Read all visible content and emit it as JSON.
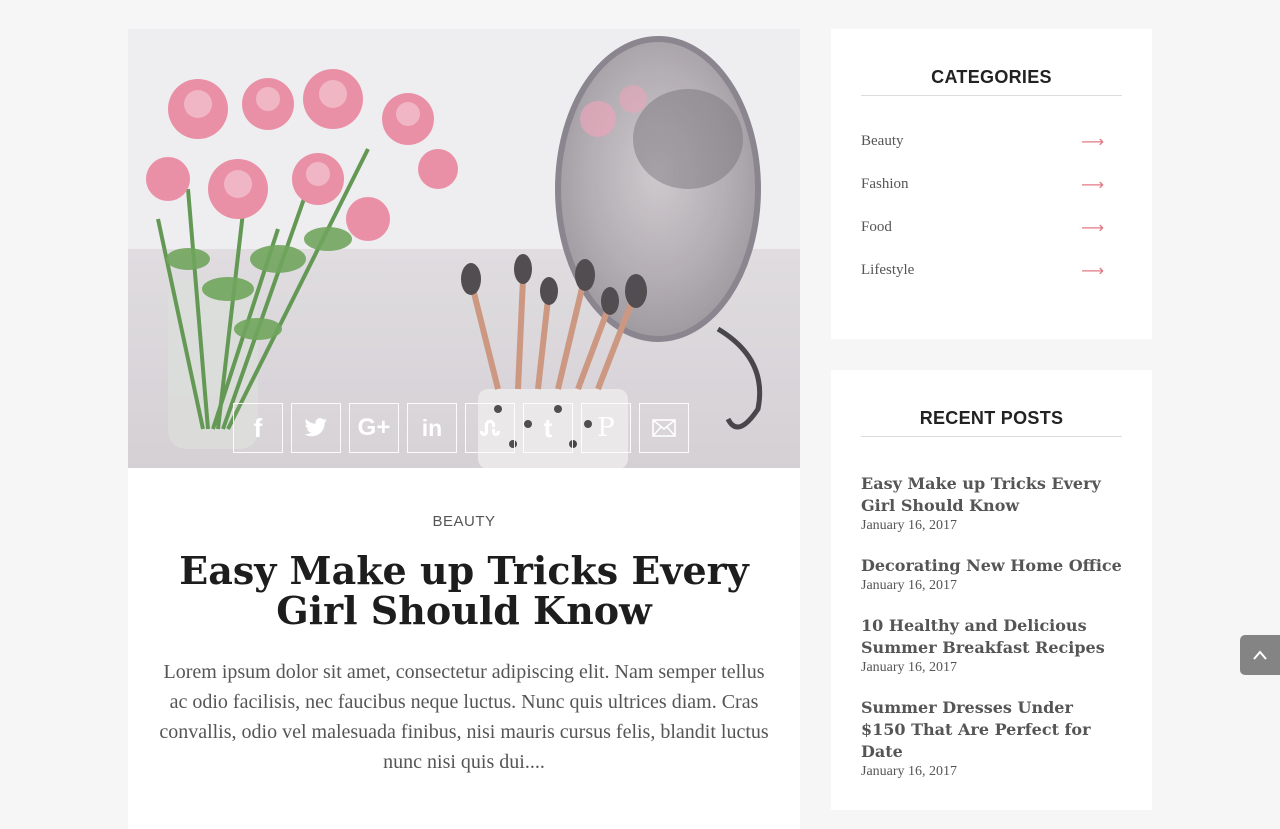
{
  "post": {
    "category": "BEAUTY",
    "title": "Easy Make up Tricks Every Girl Should Know",
    "excerpt": "Lorem ipsum dolor sit amet, consectetur adipiscing elit. Nam semper tellus ac odio facilisis, nec faucibus neque luctus. Nunc quis ultrices diam. Cras convallis, odio vel malesuada finibus, nisi mauris cursus felis, blandit luctus nunc nisi quis dui....",
    "share_icons": [
      "facebook-icon",
      "twitter-icon",
      "google-plus-icon",
      "linkedin-icon",
      "stumbleupon-icon",
      "tumblr-icon",
      "pinterest-icon",
      "email-icon"
    ]
  },
  "categories": {
    "title": "CATEGORIES",
    "items": [
      {
        "label": "Beauty"
      },
      {
        "label": "Fashion"
      },
      {
        "label": "Food"
      },
      {
        "label": "Lifestyle"
      }
    ],
    "arrow_color": "#e27a85"
  },
  "recent_posts": {
    "title": "RECENT POSTS",
    "items": [
      {
        "title": "Easy Make up Tricks Every Girl Should Know",
        "date": "January 16, 2017"
      },
      {
        "title": "Decorating New Home Office",
        "date": "January 16, 2017"
      },
      {
        "title": "10 Healthy and Delicious Summer Breakfast Recipes",
        "date": "January 16, 2017"
      },
      {
        "title": "Summer Dresses Under $150 That Are Perfect for Date",
        "date": "January 16, 2017"
      }
    ]
  },
  "back_to_top": {
    "icon": "chevron-up-icon"
  }
}
